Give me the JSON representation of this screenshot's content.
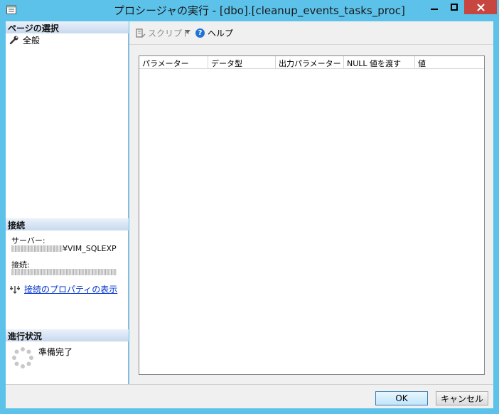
{
  "window": {
    "title": "プロシージャの実行 - [dbo].[cleanup_events_tasks_proc]"
  },
  "left": {
    "page_select_header": "ページの選択",
    "pages": [
      {
        "label": "全般",
        "icon": "wrench-icon"
      }
    ],
    "connection_header": "接続",
    "server_label": "サーバー:",
    "server_value_suffix": "¥VIM_SQLEXP",
    "connection_label": "接続:",
    "connection_props_link": "接続のプロパティの表示",
    "progress_header": "進行状況",
    "progress_status": "準備完了"
  },
  "toolbar": {
    "script_label": "スクリプト",
    "help_label": "ヘルプ"
  },
  "grid": {
    "columns": [
      "パラメーター",
      "データ型",
      "出力パラメーター",
      "NULL 値を渡す",
      "値"
    ],
    "rows": []
  },
  "buttons": {
    "ok": "OK",
    "cancel": "キャンセル"
  },
  "colors": {
    "window_frame": "#5cc2ea",
    "close_button": "#c7463f",
    "link": "#0033cc"
  }
}
